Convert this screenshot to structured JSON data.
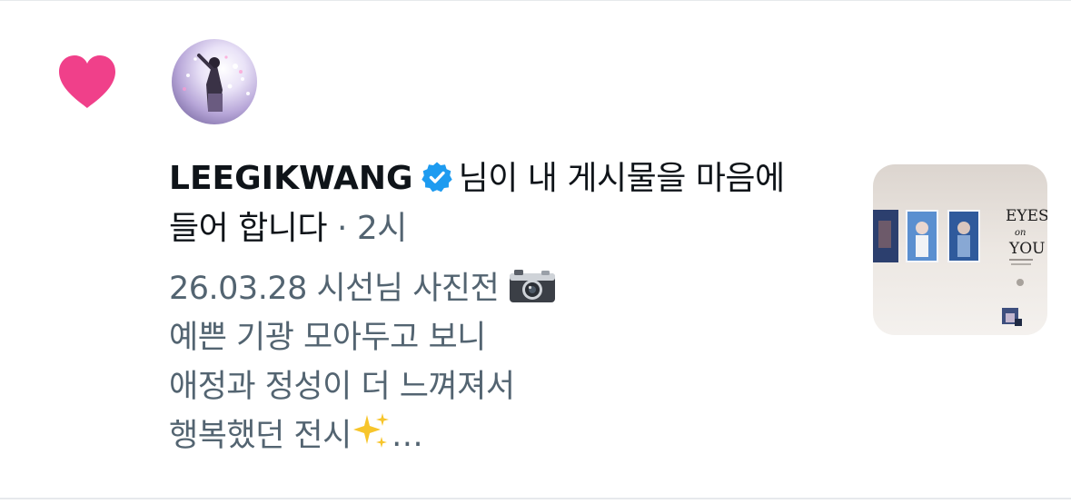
{
  "notification": {
    "type_icon": "heart-icon",
    "username": "LEEGIKWANG",
    "verified_icon": "verified-badge-icon",
    "action_text": "님이 내 게시물을 마음에 들어 합니다",
    "separator": "·",
    "time": "2시",
    "post_lines": [
      "26.03.28 시선님 사진전",
      "예쁜 기광 모아두고 보니",
      "애정과 정성이 더 느껴져서",
      "행복했던 전시"
    ],
    "post_line1_emoji": "camera-icon",
    "post_line4_emoji": "sparkles-icon",
    "ellipsis": "…",
    "thumbnail_text": [
      "EYES",
      "on",
      "YOU"
    ],
    "colors": {
      "heart": "#f0408a",
      "verified": "#1d9bf0",
      "text_primary": "#0f1419",
      "text_secondary": "#536471",
      "divider": "#e6e9ec"
    }
  }
}
